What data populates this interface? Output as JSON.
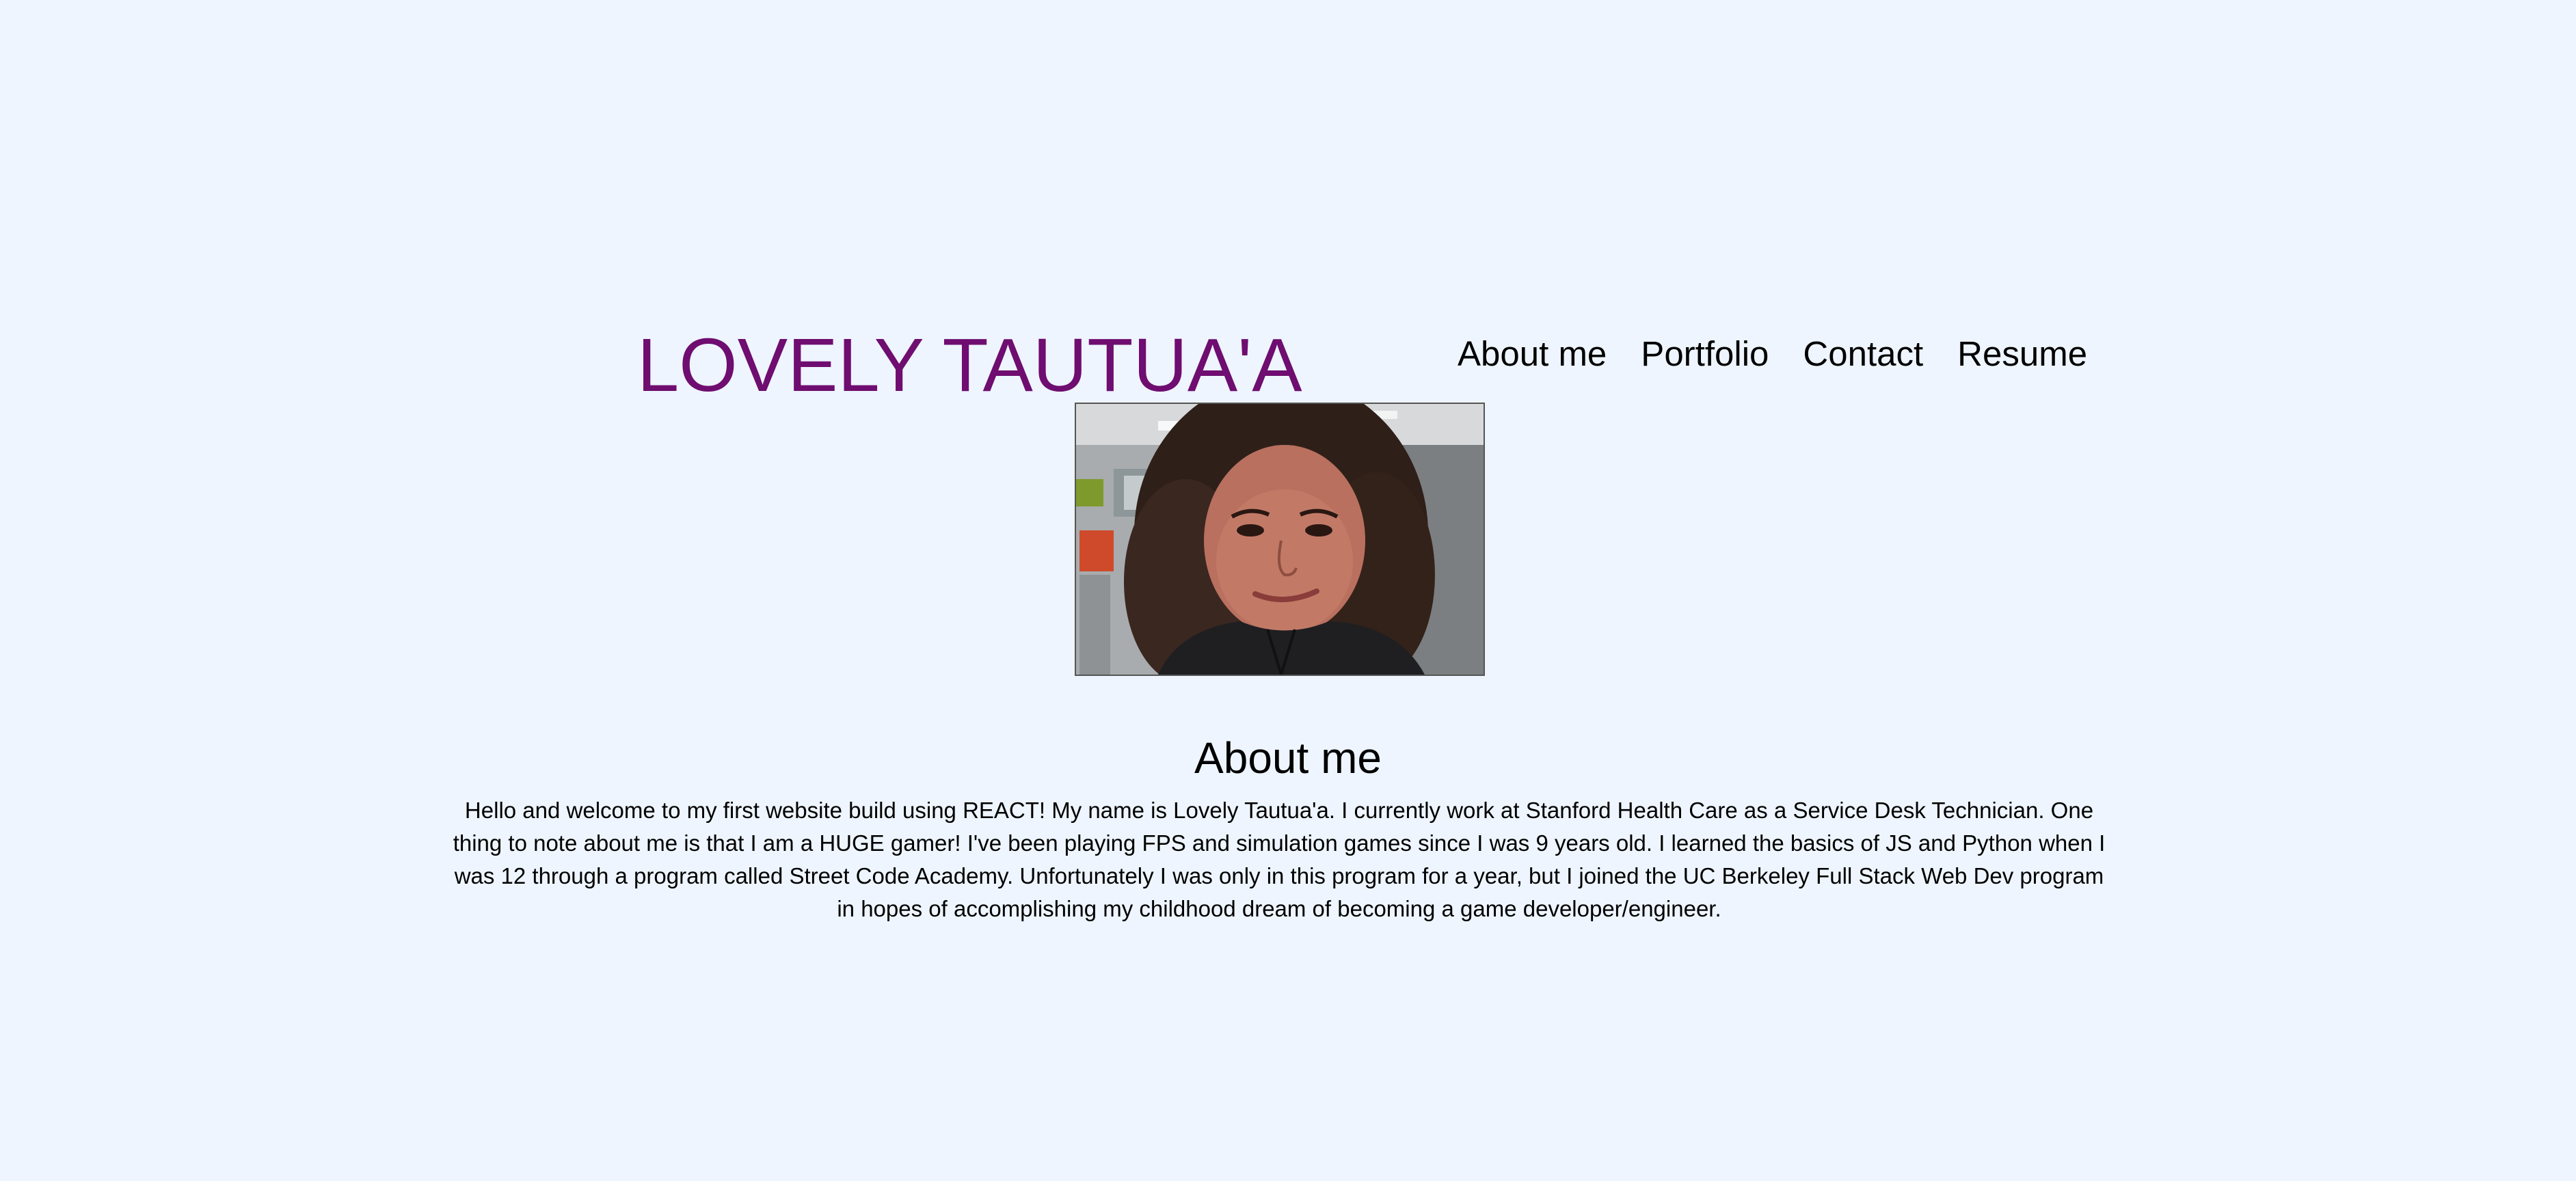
{
  "header": {
    "title": "LOVELY TAUTUA'A",
    "title_color": "#6f0d70"
  },
  "nav": {
    "items": [
      {
        "label": "About me"
      },
      {
        "label": "Portfolio"
      },
      {
        "label": "Contact"
      },
      {
        "label": "Resume"
      }
    ]
  },
  "profile": {
    "photo_icon": "profile-photo"
  },
  "about": {
    "heading": "About me",
    "body": "Hello and welcome to my first website build using REACT! My name is Lovely Tautua'a. I currently work at Stanford Health Care as a Service Desk Technician. One thing to note about me is that I am a HUGE gamer! I've been playing FPS and simulation games since I was 9 years old. I learned the basics of JS and Python when I was 12 through a program called Street Code Academy. Unfortunately I was only in this program for a year, but I joined the UC Berkeley Full Stack Web Dev program in hopes of accomplishing my childhood dream of becoming a game developer/engineer."
  },
  "colors": {
    "background": "#eef5fe",
    "text": "#000000"
  }
}
